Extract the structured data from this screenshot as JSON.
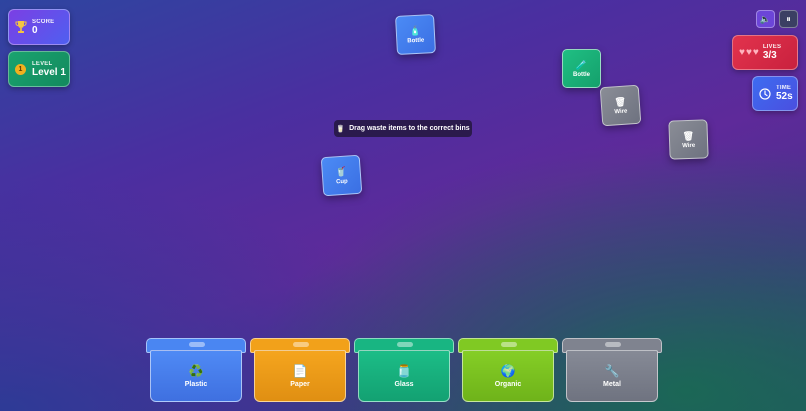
{
  "hud": {
    "score": {
      "label": "SCORE",
      "value": "0"
    },
    "level": {
      "label": "LEVEL",
      "badge": "1",
      "value": "Level 1"
    },
    "lives": {
      "label": "LIVES",
      "value": "3/3",
      "hearts": 3
    },
    "time": {
      "label": "TIME",
      "value": "52s"
    }
  },
  "controls": {
    "sound_icon": "🔈",
    "pause_icon": "⏸"
  },
  "hint": {
    "icon": "🥛",
    "text": "Drag waste items to the correct bins"
  },
  "items": [
    {
      "label": "Bottle",
      "icon": "🧴",
      "kind": "blue"
    },
    {
      "label": "Bottle",
      "icon": "🧪",
      "kind": "green"
    },
    {
      "label": "Wire",
      "icon": "🗑",
      "kind": "gray"
    },
    {
      "label": "Wire",
      "icon": "🗑",
      "kind": "gray"
    },
    {
      "label": "Cup",
      "icon": "🥤",
      "kind": "blue"
    }
  ],
  "bins": [
    {
      "label": "Plastic",
      "icon": "♻️",
      "color": "#4a86f2"
    },
    {
      "label": "Paper",
      "icon": "📄",
      "color": "#f2a11a"
    },
    {
      "label": "Glass",
      "icon": "🫙",
      "color": "#18b582"
    },
    {
      "label": "Organic",
      "icon": "🌍",
      "color": "#80c923"
    },
    {
      "label": "Metal",
      "icon": "🔧",
      "color": "#7f838f"
    }
  ]
}
